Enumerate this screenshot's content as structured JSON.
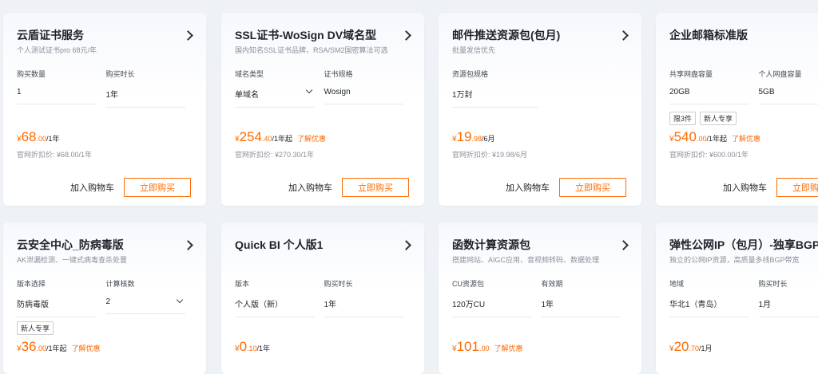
{
  "cards": [
    {
      "title": "云盾证书服务",
      "desc": "个人测试证书pro 68元/年",
      "spec1": {
        "label": "购买数量",
        "value": "1"
      },
      "spec2": {
        "label": "购买时长",
        "value": "1年"
      },
      "price": {
        "currency": "¥",
        "int": "68",
        "dec": ".00",
        "unit": "/1年"
      },
      "orig": "官网折扣价: ¥68.00/1年",
      "cart": "加入购物车",
      "buy": "立即购买"
    },
    {
      "title": "SSL证书-WoSign DV域名型",
      "desc": "国内知名SSL证书品牌，RSA/SM2国密算法可选",
      "spec1": {
        "label": "域名类型",
        "value": "单域名"
      },
      "spec2": {
        "label": "证书规格",
        "value": "Wosign"
      },
      "price": {
        "currency": "¥",
        "int": "254",
        "dec": ".40",
        "unit": "/1年起",
        "promo": "了解优惠"
      },
      "orig": "官网折扣价: ¥270.30/1年",
      "cart": "加入购物车",
      "buy": "立即购买"
    },
    {
      "title": "邮件推送资源包(包月)",
      "desc": "批量发信优先",
      "spec1": {
        "label": "资源包规格",
        "value": "1万封"
      },
      "price": {
        "currency": "¥",
        "int": "19",
        "dec": ".98",
        "unit": "/6月"
      },
      "orig": "官网折扣价: ¥19.98/6月",
      "cart": "加入购物车",
      "buy": "立即购买"
    },
    {
      "title": "企业邮箱标准版",
      "spec1": {
        "label": "共享网盘容量",
        "value": "20GB"
      },
      "spec2": {
        "label": "个人网盘容量",
        "value": "5GB"
      },
      "tags": [
        "限3件",
        "新人专享"
      ],
      "price": {
        "currency": "¥",
        "int": "540",
        "dec": ".00",
        "unit": "/1年起",
        "promo": "了解优惠"
      },
      "orig": "官网折扣价: ¥600.00/1年",
      "cart": "加入购物车",
      "buy": "立即购买"
    },
    {
      "title": "云安全中心_防病毒版",
      "desc": "AK泄漏检测、一键式病毒查杀处置",
      "spec1": {
        "label": "版本选择",
        "value": "防病毒版"
      },
      "spec2": {
        "label": "计算核数",
        "value": "2"
      },
      "tags": [
        "新人专享"
      ],
      "price": {
        "currency": "¥",
        "int": "36",
        "dec": ".00",
        "unit": "/1年起",
        "promo": "了解优惠"
      }
    },
    {
      "title": "Quick BI 个人版1",
      "spec1": {
        "label": "版本",
        "value": "个人版（新）"
      },
      "spec2": {
        "label": "购买时长",
        "value": "1年"
      },
      "price": {
        "currency": "¥",
        "int": "0",
        "dec": ".10",
        "unit": "/1年"
      }
    },
    {
      "title": "函数计算资源包",
      "desc": "搭建网站、AIGC应用、音视频转码、数据处理",
      "spec1": {
        "label": "CU资源包",
        "value": "120万CU"
      },
      "spec2": {
        "label": "有效期",
        "value": "1年"
      },
      "price": {
        "currency": "¥",
        "int": "101",
        "dec": ".00",
        "unit": "",
        "promo": "了解优惠"
      }
    },
    {
      "title": "弹性公网IP（包月）-独享BGP带宽",
      "desc": "独立的公网IP资源，高质量多线BGP带宽",
      "spec1": {
        "label": "地域",
        "value": "华北1（青岛）"
      },
      "spec2": {
        "label": "购买时长",
        "value": "1月"
      },
      "price": {
        "currency": "¥",
        "int": "20",
        "dec": ".70",
        "unit": "/1月"
      }
    }
  ]
}
